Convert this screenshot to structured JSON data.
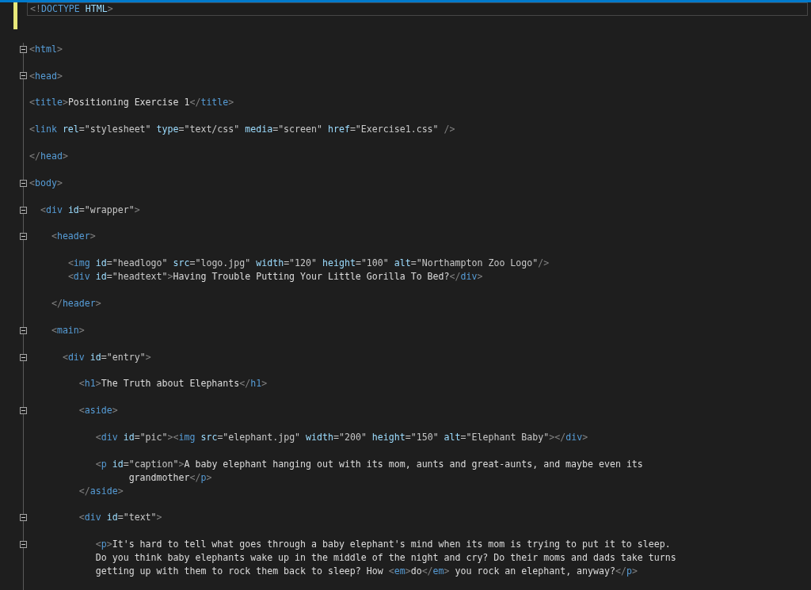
{
  "editor": {
    "lines": [
      {
        "changed": true,
        "current": true,
        "foldable": false,
        "tokens": [
          {
            "kind": "punct",
            "text": "<!"
          },
          {
            "kind": "tag",
            "text": "DOCTYPE"
          },
          {
            "kind": "attr",
            "text": " HTML"
          },
          {
            "kind": "punct",
            "text": ">"
          }
        ]
      },
      {
        "changed": true,
        "current": false,
        "foldable": false
      },
      {
        "changed": false,
        "current": false,
        "foldable": false
      },
      {
        "changed": false,
        "current": false,
        "foldable": true,
        "tokens": [
          {
            "kind": "punct",
            "text": "<"
          },
          {
            "kind": "tag",
            "text": "html"
          },
          {
            "kind": "punct",
            "text": ">"
          }
        ]
      },
      {
        "changed": false,
        "current": false,
        "foldable": false
      },
      {
        "changed": false,
        "current": false,
        "foldable": true,
        "tokens": [
          {
            "kind": "punct",
            "text": "<"
          },
          {
            "kind": "tag",
            "text": "head"
          },
          {
            "kind": "punct",
            "text": ">"
          }
        ]
      },
      {
        "changed": false,
        "current": false,
        "foldable": false
      },
      {
        "changed": false,
        "current": false,
        "foldable": false,
        "tokens": [
          {
            "kind": "punct",
            "text": "<"
          },
          {
            "kind": "tag",
            "text": "title"
          },
          {
            "kind": "punct",
            "text": ">"
          },
          {
            "kind": "text",
            "text": "Positioning Exercise 1"
          },
          {
            "kind": "punct",
            "text": "</"
          },
          {
            "kind": "tag",
            "text": "title"
          },
          {
            "kind": "punct",
            "text": ">"
          }
        ]
      },
      {
        "changed": false,
        "current": false,
        "foldable": false
      },
      {
        "changed": false,
        "current": false,
        "foldable": false,
        "tokens": [
          {
            "kind": "punct",
            "text": "<"
          },
          {
            "kind": "tag",
            "text": "link"
          },
          {
            "kind": "attr",
            "text": " rel"
          },
          {
            "kind": "value",
            "text": "=\"stylesheet\""
          },
          {
            "kind": "attr",
            "text": " type"
          },
          {
            "kind": "value",
            "text": "=\"text/css\""
          },
          {
            "kind": "attr",
            "text": " media"
          },
          {
            "kind": "value",
            "text": "=\"screen\""
          },
          {
            "kind": "attr",
            "text": " href"
          },
          {
            "kind": "value",
            "text": "=\"Exercise1.css\""
          },
          {
            "kind": "punct",
            "text": " />"
          }
        ]
      },
      {
        "changed": false,
        "current": false,
        "foldable": false
      },
      {
        "changed": false,
        "current": false,
        "foldable": false,
        "tokens": [
          {
            "kind": "punct",
            "text": "</"
          },
          {
            "kind": "tag",
            "text": "head"
          },
          {
            "kind": "punct",
            "text": ">"
          }
        ]
      },
      {
        "changed": false,
        "current": false,
        "foldable": false
      },
      {
        "changed": false,
        "current": false,
        "foldable": true,
        "tokens": [
          {
            "kind": "punct",
            "text": "<"
          },
          {
            "kind": "tag",
            "text": "body"
          },
          {
            "kind": "punct",
            "text": ">"
          }
        ]
      },
      {
        "changed": false,
        "current": false,
        "foldable": false
      },
      {
        "changed": false,
        "current": false,
        "foldable": true,
        "tokens": [
          {
            "kind": "punct",
            "text": "  <"
          },
          {
            "kind": "tag",
            "text": "div"
          },
          {
            "kind": "attr",
            "text": " id"
          },
          {
            "kind": "value",
            "text": "=\"wrapper\""
          },
          {
            "kind": "punct",
            "text": ">"
          }
        ]
      },
      {
        "changed": false,
        "current": false,
        "foldable": false
      },
      {
        "changed": false,
        "current": false,
        "foldable": true,
        "tokens": [
          {
            "kind": "punct",
            "text": "    <"
          },
          {
            "kind": "tag",
            "text": "header"
          },
          {
            "kind": "punct",
            "text": ">"
          }
        ]
      },
      {
        "changed": false,
        "current": false,
        "foldable": false
      },
      {
        "changed": false,
        "current": false,
        "foldable": false,
        "tokens": [
          {
            "kind": "punct",
            "text": "       <"
          },
          {
            "kind": "tag",
            "text": "img"
          },
          {
            "kind": "attr",
            "text": " id"
          },
          {
            "kind": "value",
            "text": "=\"headlogo\""
          },
          {
            "kind": "attr",
            "text": " src"
          },
          {
            "kind": "value",
            "text": "=\"logo.jpg\""
          },
          {
            "kind": "attr",
            "text": " width"
          },
          {
            "kind": "value",
            "text": "=\"120\""
          },
          {
            "kind": "attr",
            "text": " height"
          },
          {
            "kind": "value",
            "text": "=\"100\""
          },
          {
            "kind": "attr",
            "text": " alt"
          },
          {
            "kind": "value",
            "text": "=\"Northampton Zoo Logo\""
          },
          {
            "kind": "punct",
            "text": "/>"
          }
        ]
      },
      {
        "changed": false,
        "current": false,
        "foldable": false,
        "tokens": [
          {
            "kind": "punct",
            "text": "       <"
          },
          {
            "kind": "tag",
            "text": "div"
          },
          {
            "kind": "attr",
            "text": " id"
          },
          {
            "kind": "value",
            "text": "=\"headtext\""
          },
          {
            "kind": "punct",
            "text": ">"
          },
          {
            "kind": "text",
            "text": "Having Trouble Putting Your Little Gorilla To Bed?"
          },
          {
            "kind": "punct",
            "text": "</"
          },
          {
            "kind": "tag",
            "text": "div"
          },
          {
            "kind": "punct",
            "text": ">"
          }
        ]
      },
      {
        "changed": false,
        "current": false,
        "foldable": false
      },
      {
        "changed": false,
        "current": false,
        "foldable": false,
        "tokens": [
          {
            "kind": "punct",
            "text": "    </"
          },
          {
            "kind": "tag",
            "text": "header"
          },
          {
            "kind": "punct",
            "text": ">"
          }
        ]
      },
      {
        "changed": false,
        "current": false,
        "foldable": false
      },
      {
        "changed": false,
        "current": false,
        "foldable": true,
        "tokens": [
          {
            "kind": "punct",
            "text": "    <"
          },
          {
            "kind": "tag",
            "text": "main"
          },
          {
            "kind": "punct",
            "text": ">"
          }
        ]
      },
      {
        "changed": false,
        "current": false,
        "foldable": false
      },
      {
        "changed": false,
        "current": false,
        "foldable": true,
        "tokens": [
          {
            "kind": "punct",
            "text": "      <"
          },
          {
            "kind": "tag",
            "text": "div"
          },
          {
            "kind": "attr",
            "text": " id"
          },
          {
            "kind": "value",
            "text": "=\"entry\""
          },
          {
            "kind": "punct",
            "text": ">"
          }
        ]
      },
      {
        "changed": false,
        "current": false,
        "foldable": false
      },
      {
        "changed": false,
        "current": false,
        "foldable": false,
        "tokens": [
          {
            "kind": "punct",
            "text": "         <"
          },
          {
            "kind": "tag",
            "text": "h1"
          },
          {
            "kind": "punct",
            "text": ">"
          },
          {
            "kind": "text",
            "text": "The Truth about Elephants"
          },
          {
            "kind": "punct",
            "text": "</"
          },
          {
            "kind": "tag",
            "text": "h1"
          },
          {
            "kind": "punct",
            "text": ">"
          }
        ]
      },
      {
        "changed": false,
        "current": false,
        "foldable": false
      },
      {
        "changed": false,
        "current": false,
        "foldable": true,
        "tokens": [
          {
            "kind": "punct",
            "text": "         <"
          },
          {
            "kind": "tag",
            "text": "aside"
          },
          {
            "kind": "punct",
            "text": ">"
          }
        ]
      },
      {
        "changed": false,
        "current": false,
        "foldable": false
      },
      {
        "changed": false,
        "current": false,
        "foldable": false,
        "tokens": [
          {
            "kind": "punct",
            "text": "            <"
          },
          {
            "kind": "tag",
            "text": "div"
          },
          {
            "kind": "attr",
            "text": " id"
          },
          {
            "kind": "value",
            "text": "=\"pic\""
          },
          {
            "kind": "punct",
            "text": "><"
          },
          {
            "kind": "tag",
            "text": "img"
          },
          {
            "kind": "attr",
            "text": " src"
          },
          {
            "kind": "value",
            "text": "=\"elephant.jpg\""
          },
          {
            "kind": "attr",
            "text": " width"
          },
          {
            "kind": "value",
            "text": "=\"200\""
          },
          {
            "kind": "attr",
            "text": " height"
          },
          {
            "kind": "value",
            "text": "=\"150\""
          },
          {
            "kind": "attr",
            "text": " alt"
          },
          {
            "kind": "value",
            "text": "=\"Elephant Baby\""
          },
          {
            "kind": "punct",
            "text": "></"
          },
          {
            "kind": "tag",
            "text": "div"
          },
          {
            "kind": "punct",
            "text": ">"
          }
        ]
      },
      {
        "changed": false,
        "current": false,
        "foldable": false
      },
      {
        "changed": false,
        "current": false,
        "foldable": false,
        "tokens": [
          {
            "kind": "punct",
            "text": "            <"
          },
          {
            "kind": "tag",
            "text": "p"
          },
          {
            "kind": "attr",
            "text": " id"
          },
          {
            "kind": "value",
            "text": "=\"caption\""
          },
          {
            "kind": "punct",
            "text": ">"
          },
          {
            "kind": "text",
            "text": "A baby elephant hanging out with its mom, aunts and great-aunts, and maybe even its"
          }
        ]
      },
      {
        "changed": false,
        "current": false,
        "foldable": false,
        "tokens": [
          {
            "kind": "text",
            "text": "                  grandmother"
          },
          {
            "kind": "punct",
            "text": "</"
          },
          {
            "kind": "tag",
            "text": "p"
          },
          {
            "kind": "punct",
            "text": ">"
          }
        ]
      },
      {
        "changed": false,
        "current": false,
        "foldable": false,
        "tokens": [
          {
            "kind": "punct",
            "text": "         </"
          },
          {
            "kind": "tag",
            "text": "aside"
          },
          {
            "kind": "punct",
            "text": ">"
          }
        ]
      },
      {
        "changed": false,
        "current": false,
        "foldable": false
      },
      {
        "changed": false,
        "current": false,
        "foldable": true,
        "tokens": [
          {
            "kind": "punct",
            "text": "         <"
          },
          {
            "kind": "tag",
            "text": "div"
          },
          {
            "kind": "attr",
            "text": " id"
          },
          {
            "kind": "value",
            "text": "=\"text\""
          },
          {
            "kind": "punct",
            "text": ">"
          }
        ]
      },
      {
        "changed": false,
        "current": false,
        "foldable": false
      },
      {
        "changed": false,
        "current": false,
        "foldable": true,
        "tokens": [
          {
            "kind": "punct",
            "text": "            <"
          },
          {
            "kind": "tag",
            "text": "p"
          },
          {
            "kind": "punct",
            "text": ">"
          },
          {
            "kind": "text",
            "text": "It's hard to tell what goes through a baby elephant's mind when its mom is trying to put it to sleep."
          }
        ]
      },
      {
        "changed": false,
        "current": false,
        "foldable": false,
        "tokens": [
          {
            "kind": "text",
            "text": "            Do you think baby elephants wake up in the middle of the night and cry? Do their moms and dads take turns"
          }
        ]
      },
      {
        "changed": false,
        "current": false,
        "foldable": false,
        "tokens": [
          {
            "kind": "text",
            "text": "            getting up with them to rock them back to sleep? How "
          },
          {
            "kind": "punct",
            "text": "<"
          },
          {
            "kind": "tag",
            "text": "em"
          },
          {
            "kind": "punct",
            "text": ">"
          },
          {
            "kind": "text",
            "text": "do"
          },
          {
            "kind": "punct",
            "text": "</"
          },
          {
            "kind": "tag",
            "text": "em"
          },
          {
            "kind": "punct",
            "text": ">"
          },
          {
            "kind": "text",
            "text": " you rock an elephant, anyway?"
          },
          {
            "kind": "punct",
            "text": "</"
          },
          {
            "kind": "tag",
            "text": "p"
          },
          {
            "kind": "punct",
            "text": ">"
          }
        ]
      },
      {
        "changed": false,
        "current": false,
        "foldable": false
      }
    ]
  }
}
